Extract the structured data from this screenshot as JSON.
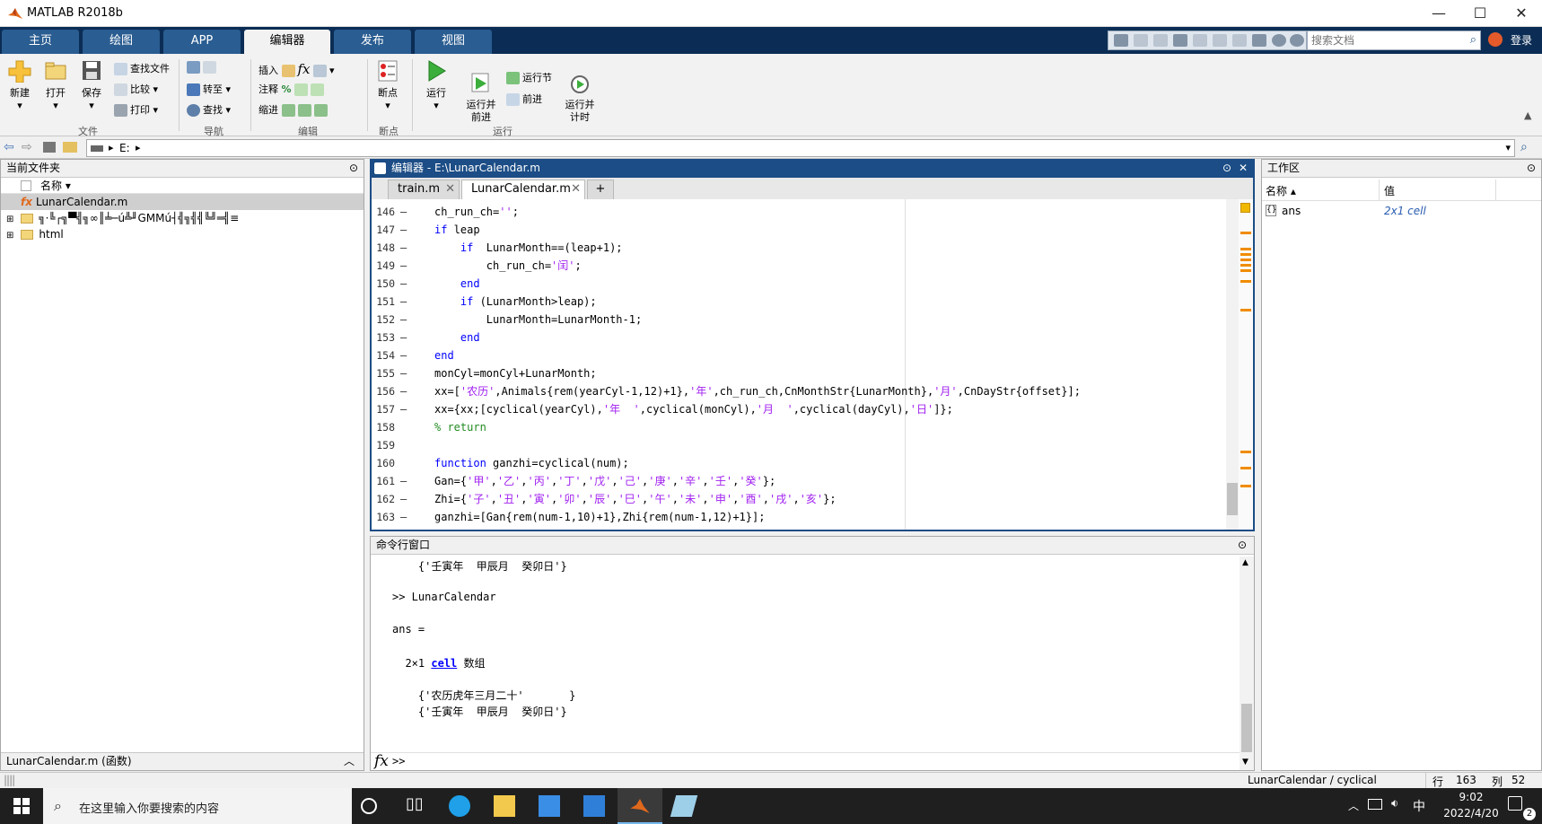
{
  "window": {
    "title": "MATLAB R2018b"
  },
  "ribbon_tabs": [
    {
      "label": "主页"
    },
    {
      "label": "绘图"
    },
    {
      "label": "APP"
    },
    {
      "label": "编辑器"
    },
    {
      "label": "发布"
    },
    {
      "label": "视图"
    }
  ],
  "search": {
    "placeholder": "搜索文档"
  },
  "login_label": "登录",
  "toolstrip": {
    "file": {
      "new": "新建",
      "open": "打开",
      "save": "保存",
      "find_files": "查找文件",
      "compare": "比较",
      "print": "打印",
      "group": "文件"
    },
    "nav": {
      "goto": "转至",
      "find": "查找",
      "group": "导航"
    },
    "edit": {
      "insert": "插入",
      "comment": "注释",
      "indent": "缩进",
      "group": "编辑"
    },
    "breakpoints": {
      "label": "断点",
      "group": "断点"
    },
    "run": {
      "run": "运行",
      "run_advance": "运行并\n前进",
      "run_section": "运行节",
      "advance": "前进",
      "run_time": "运行并\n计时",
      "group": "运行"
    }
  },
  "address": {
    "path": "E:"
  },
  "current_folder": {
    "title": "当前文件夹",
    "column": "名称",
    "items": [
      {
        "name": "LunarCalendar.m",
        "type": "file"
      },
      {
        "name": "╗·╚┌╗▀╣╗∞║╧─ú╩╜GMMú┤╣╗╣╣╚╝═╣≡",
        "type": "folder"
      },
      {
        "name": "html",
        "type": "folder"
      }
    ],
    "details": "LunarCalendar.m (函数)"
  },
  "editor": {
    "title": "编辑器 - E:\\LunarCalendar.m",
    "tabs": [
      {
        "label": "train.m"
      },
      {
        "label": "LunarCalendar.m"
      }
    ],
    "lines": [
      {
        "n": "146",
        "d": "–",
        "c": "ch_run_ch='';"
      },
      {
        "n": "147",
        "d": "–",
        "c": "if leap"
      },
      {
        "n": "148",
        "d": "–",
        "c": "    if  LunarMonth==(leap+1);"
      },
      {
        "n": "149",
        "d": "–",
        "c": "        ch_run_ch='闰';"
      },
      {
        "n": "150",
        "d": "–",
        "c": "    end"
      },
      {
        "n": "151",
        "d": "–",
        "c": "    if (LunarMonth>leap);"
      },
      {
        "n": "152",
        "d": "–",
        "c": "        LunarMonth=LunarMonth-1;"
      },
      {
        "n": "153",
        "d": "–",
        "c": "    end"
      },
      {
        "n": "154",
        "d": "–",
        "c": "end"
      },
      {
        "n": "155",
        "d": "–",
        "c": "monCyl=monCyl+LunarMonth;"
      },
      {
        "n": "156",
        "d": "–",
        "c": "xx=['农历',Animals{rem(yearCyl-1,12)+1},'年',ch_run_ch,CnMonthStr{LunarMonth},'月',CnDayStr{offset}];"
      },
      {
        "n": "157",
        "d": "–",
        "c": "xx={xx;[cyclical(yearCyl),'年  ',cyclical(monCyl),'月  ',cyclical(dayCyl),'日']};"
      },
      {
        "n": "158",
        "d": "",
        "c": "% return"
      },
      {
        "n": "159",
        "d": "",
        "c": ""
      },
      {
        "n": "160",
        "d": "",
        "c": "function ganzhi=cyclical(num);"
      },
      {
        "n": "161",
        "d": "–",
        "c": "Gan={'甲','乙','丙','丁','戊','己','庚','辛','壬','癸'};"
      },
      {
        "n": "162",
        "d": "–",
        "c": "Zhi={'子','丑','寅','卯','辰','巳','午','未','申','酉','戌','亥'};"
      },
      {
        "n": "163",
        "d": "–",
        "c": "ganzhi=[Gan{rem(num-1,10)+1},Zhi{rem(num-1,12)+1}];"
      }
    ]
  },
  "command_window": {
    "title": "命令行窗口",
    "lines": [
      "    {'壬寅年  甲辰月  癸卯日'}",
      "",
      ">> LunarCalendar",
      "",
      "ans =",
      "",
      "  2×1 cell 数组",
      "",
      "    {'农历虎年三月二十'       }",
      "    {'壬寅年  甲辰月  癸卯日'}"
    ],
    "prompt": ">>"
  },
  "workspace": {
    "title": "工作区",
    "col_name": "名称",
    "col_value": "值",
    "rows": [
      {
        "name": "ans",
        "value": "2x1 cell"
      }
    ]
  },
  "status": {
    "function": "LunarCalendar / cyclical",
    "row_label": "行",
    "row": "163",
    "col_label": "列",
    "col": "52"
  },
  "taskbar": {
    "search_placeholder": "在这里输入你要搜索的内容",
    "ime": "中",
    "time": "9:02",
    "date": "2022/4/20",
    "notifications": "2"
  }
}
